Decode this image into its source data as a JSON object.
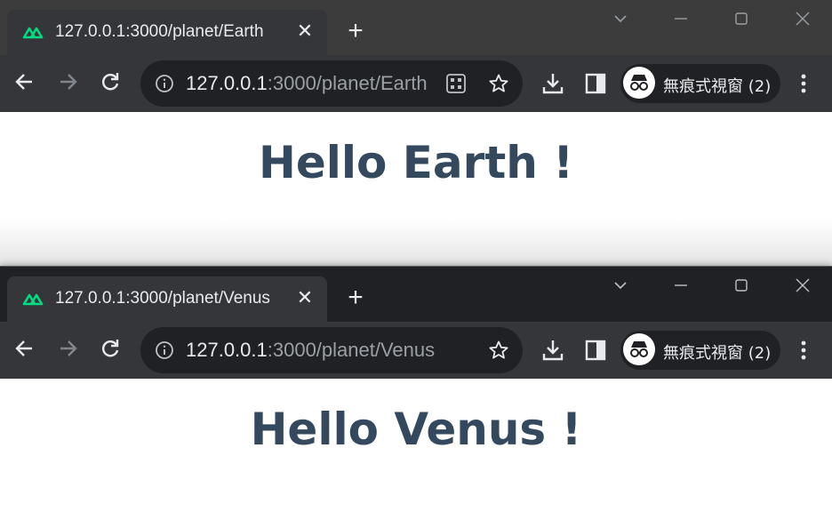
{
  "windows": [
    {
      "tab": {
        "title": "127.0.0.1:3000/planet/Earth"
      },
      "address": {
        "host": "127.0.0.1",
        "path": ":3000/planet/Earth"
      },
      "incognito_label": "無痕式視窗 (2)",
      "greeting": "Hello Earth !"
    },
    {
      "tab": {
        "title": "127.0.0.1:3000/planet/Venus"
      },
      "address": {
        "host": "127.0.0.1",
        "path": ":3000/planet/Venus"
      },
      "incognito_label": "無痕式視窗 (2)",
      "greeting": "Hello Venus !"
    }
  ],
  "colors": {
    "greeting_text": "#35495e",
    "nuxt_green": "#00dc82",
    "tabstrip_top": "#3c3c3c",
    "tabstrip_bottom": "#202124",
    "toolbar": "#35363a"
  }
}
